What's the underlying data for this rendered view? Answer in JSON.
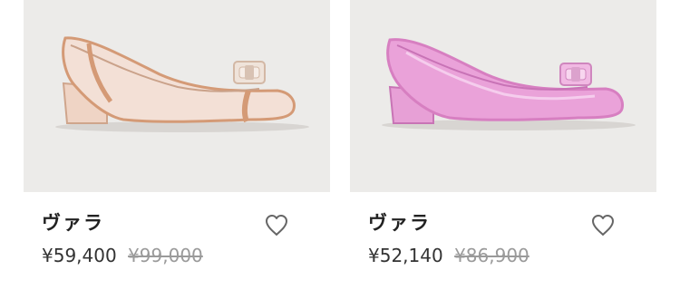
{
  "products": [
    {
      "name": "ヴァラ",
      "price": "¥59,400",
      "original_price": "¥99,000",
      "image_icon": "beige-pump-shoe-with-bow",
      "favorite_icon": "heart-outline-icon",
      "colors": {
        "body": "#f2ddd1",
        "trim": "#d49a76",
        "bow": "#efe3da"
      }
    },
    {
      "name": "ヴァラ",
      "price": "¥52,140",
      "original_price": "¥86,900",
      "image_icon": "pink-pump-shoe-with-bow",
      "favorite_icon": "heart-outline-icon",
      "colors": {
        "body": "#e79bd4",
        "trim": "#d77fc1",
        "bow": "#f1b9e3"
      }
    }
  ]
}
